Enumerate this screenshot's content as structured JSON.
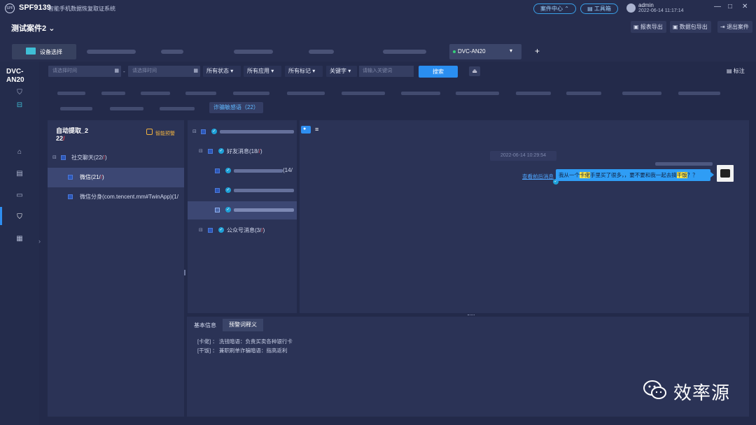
{
  "app": {
    "logo_text": "SPF",
    "code": "SPF9139",
    "name": "智能手机数据恢复取证系统",
    "case_center": "案件中心",
    "toolbox": "工具箱",
    "user": "admin",
    "datetime": "2022-06-14 11:17:14",
    "window_min": "—",
    "window_max": "□",
    "window_close": "✕"
  },
  "case": {
    "name": "测试案件2",
    "report_export": "报表导出",
    "data_export": "数据包导出",
    "exit_case": "退出案件"
  },
  "tabs": {
    "device_select": "设备选择",
    "active": "DVC-AN20"
  },
  "nav": {
    "device_name": "DVC-AN20"
  },
  "filter": {
    "start_placeholder": "请选择时间",
    "end_placeholder": "请选择时间",
    "status": "所有状态",
    "app": "所有应用",
    "tag": "所有标记",
    "keyword": "关键字",
    "keyword_placeholder": "请输入关键词",
    "search": "搜索",
    "note": "标注"
  },
  "categories": {
    "active": "诈骗敏感语（22）"
  },
  "panel1": {
    "title": "自动提取_2",
    "count": "22",
    "badge": "智能预警",
    "social": "社交聊天(22/",
    "social_mark": ")",
    "wechat": "微信(21/",
    "wechat_mark": ")",
    "wechat_twin": "微信分身(com.tencent.mm#TwinApp)(1/"
  },
  "panel2": {
    "friends": "好友消息(18/",
    "friends_mark": ")",
    "row1_count": "(14/",
    "official": "公众号消息(3/",
    "official_mark": ")"
  },
  "chat": {
    "time": "2022-06-14 10:29:54",
    "view_context": "查看前后消息",
    "msg_part1": "我从一个",
    "msg_hl1": "卡佬",
    "msg_part2": "手里买了很多，，要不要和我一起去搞",
    "msg_hl2": "干饭",
    "msg_part3": "？？"
  },
  "bottom": {
    "tab_basic": "基本信息",
    "tab_warning": "预警词释义",
    "line1": "[卡佬] ： 洗钱暗语：负责买卖各种银行卡",
    "line2": "[干饭] ： 兼职刷单诈骗暗语：指高返利"
  },
  "watermark": "效率源",
  "colors": {
    "accent": "#2e8ef0",
    "bubble": "#2f9df5",
    "highlight": "#f6e24a",
    "warning": "#f0b240"
  }
}
